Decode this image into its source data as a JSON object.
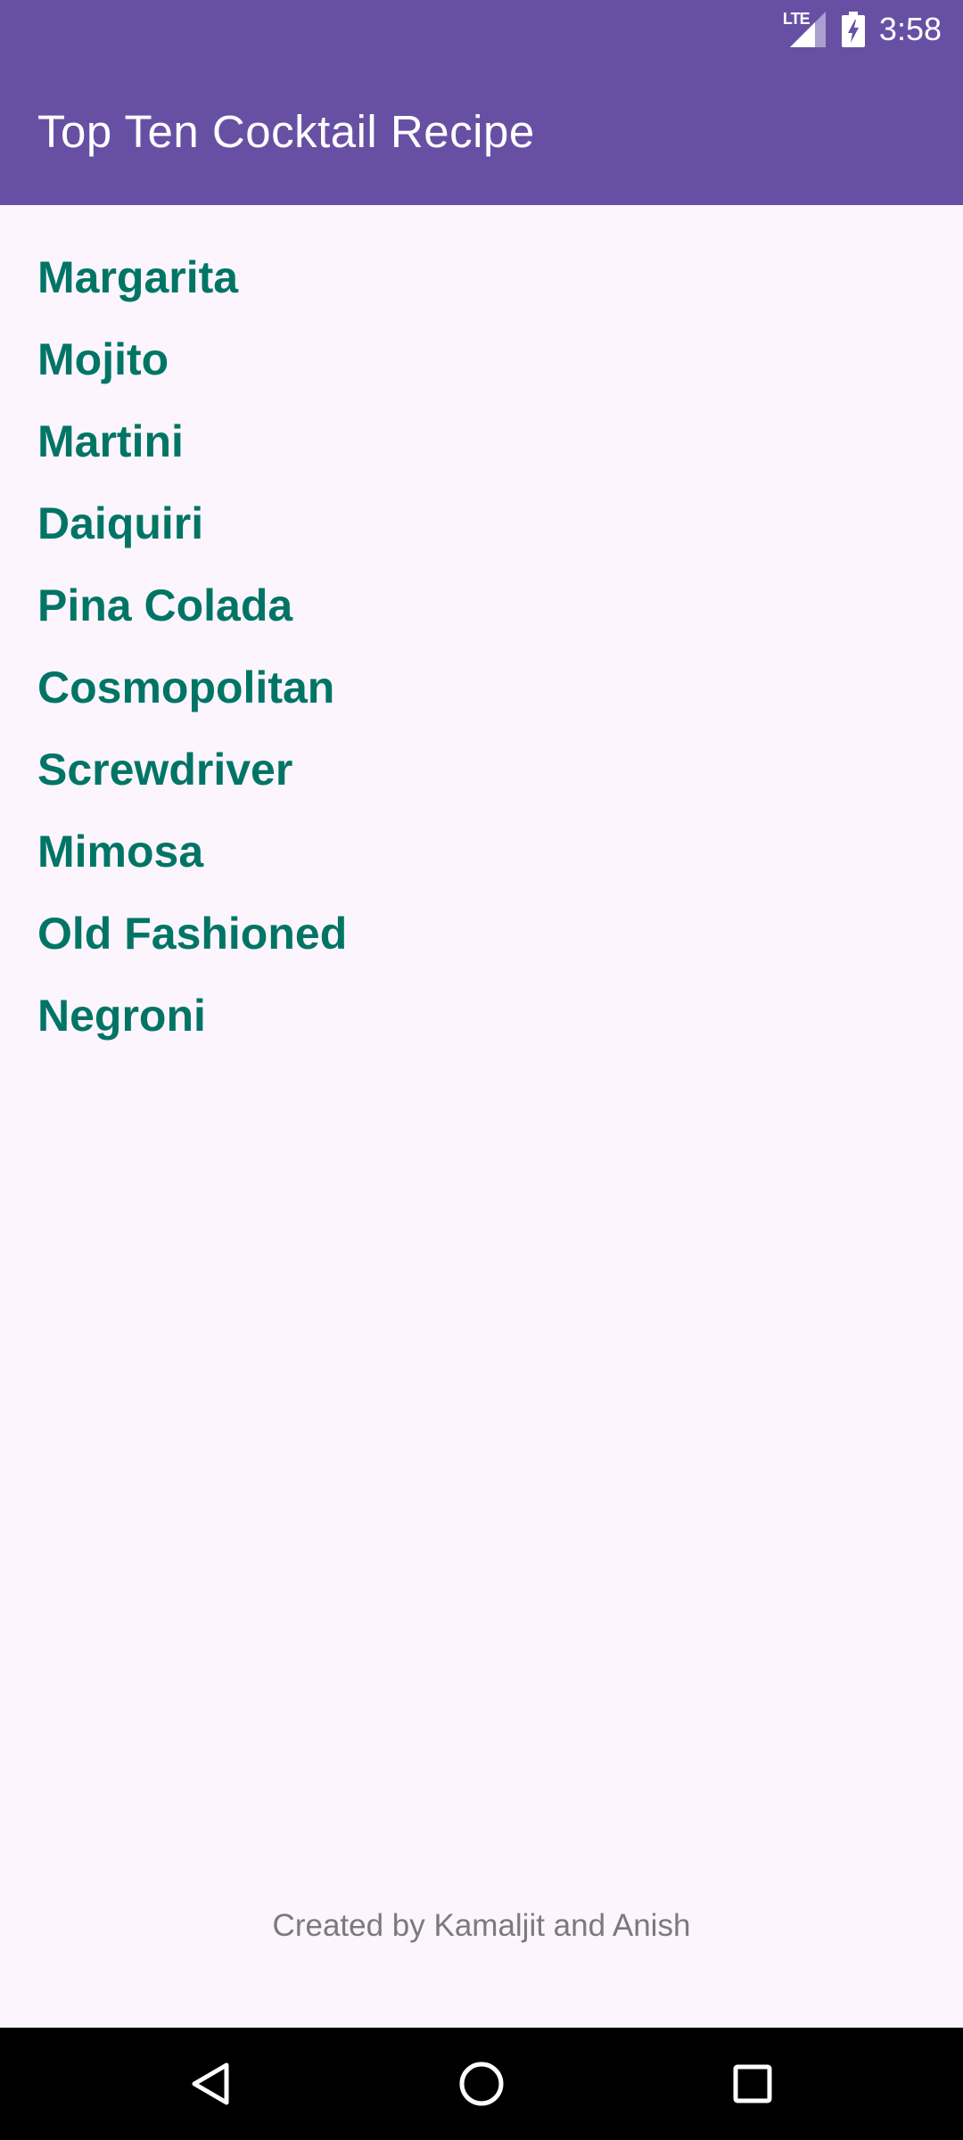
{
  "status_bar": {
    "network_label": "LTE",
    "time": "3:58",
    "icons": [
      "lte-signal-icon",
      "battery-charging-icon"
    ]
  },
  "app_bar": {
    "title": "Top Ten Cocktail Recipe",
    "color": "#6750A4"
  },
  "cocktails": [
    "Margarita",
    "Mojito",
    "Martini",
    "Daiquiri",
    "Pina Colada",
    "Cosmopolitan",
    "Screwdriver",
    "Mimosa",
    "Old Fashioned",
    "Negroni"
  ],
  "footer": {
    "credit": "Created by Kamaljit and Anish"
  },
  "navigation_bar": {
    "icons": [
      "back-icon",
      "home-icon",
      "recents-icon"
    ]
  },
  "colors": {
    "accent": "#007566",
    "background": "#FCF5FD"
  }
}
